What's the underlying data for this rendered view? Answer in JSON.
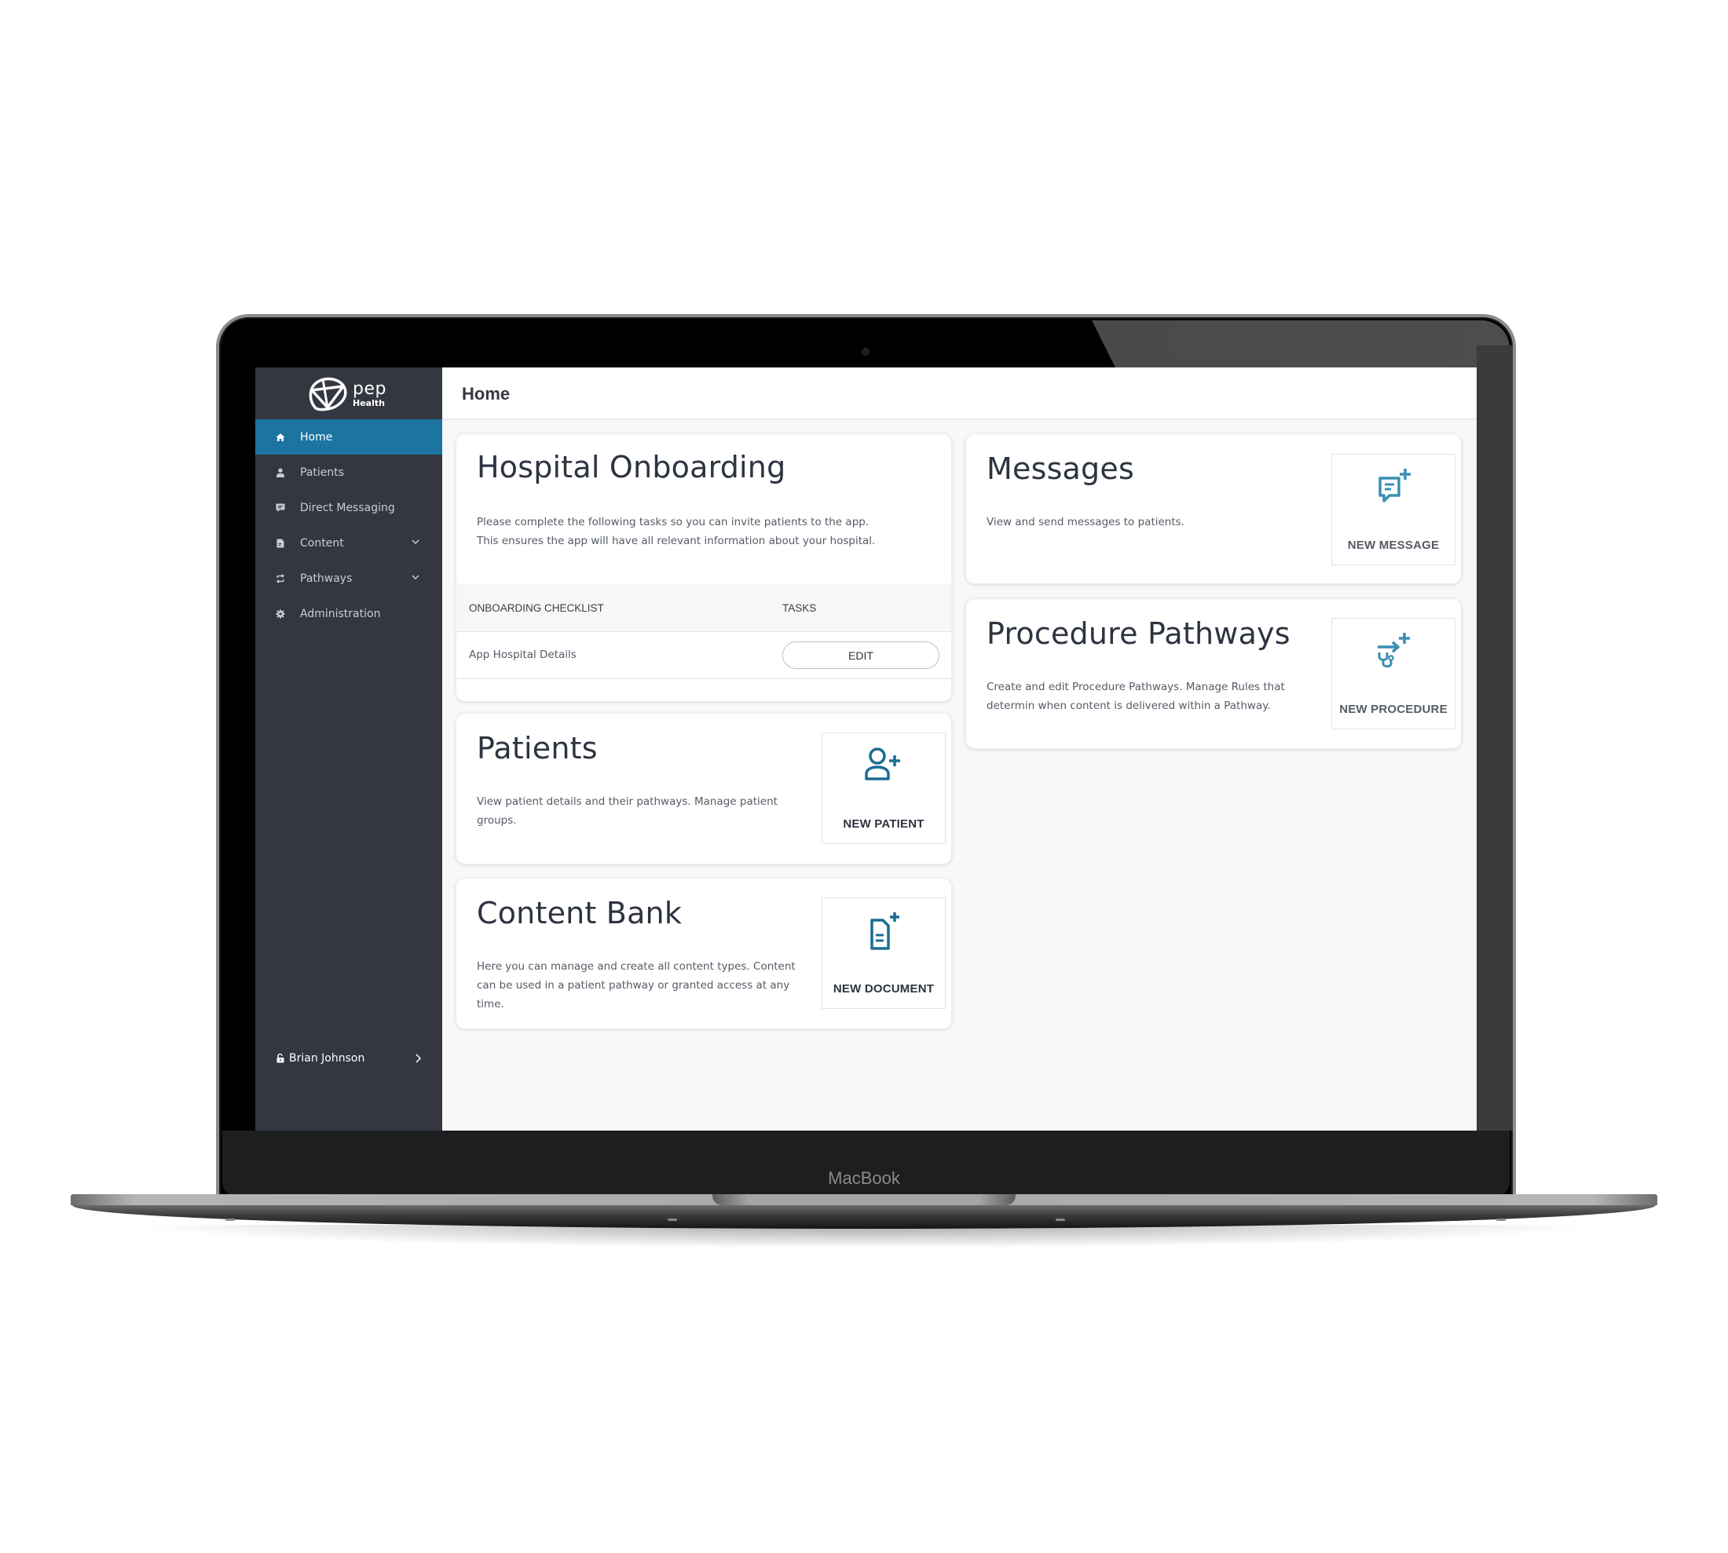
{
  "device": {
    "label": "MacBook"
  },
  "brand": {
    "name": "pep",
    "sub": "Health",
    "accent": "#1d74a0",
    "icon_color": "#1a6d94",
    "icon_color_light": "#3a8fb3"
  },
  "sidebar": {
    "items": [
      {
        "label": "Home",
        "icon": "home-icon",
        "active": true
      },
      {
        "label": "Patients",
        "icon": "user-icon"
      },
      {
        "label": "Direct Messaging",
        "icon": "chat-icon"
      },
      {
        "label": "Content",
        "icon": "document-icon",
        "expandable": true
      },
      {
        "label": "Pathways",
        "icon": "swap-icon",
        "expandable": true
      },
      {
        "label": "Administration",
        "icon": "gear-icon"
      }
    ],
    "user": {
      "name": "Brian Johnson",
      "icon": "unlock-icon"
    }
  },
  "header": {
    "title": "Home"
  },
  "cards": {
    "onboarding": {
      "title": "Hospital Onboarding",
      "desc_line1": "Please complete the following tasks so you can invite patients to the app.",
      "desc_line2": "This ensures the app will have all relevant information about your hospital.",
      "columns": [
        "ONBOARDING CHECKLIST",
        "TASKS"
      ],
      "rows": [
        {
          "label": "App Hospital Details",
          "action": "EDIT"
        }
      ]
    },
    "patients": {
      "title": "Patients",
      "desc_line1": "View patient details and their pathways. Manage patient",
      "desc_line2": "groups.",
      "action": "NEW PATIENT"
    },
    "content_bank": {
      "title": "Content Bank",
      "desc_line1": "Here you can manage and create all content types. Content",
      "desc_line2": "can be used in a patient pathway or granted access at any",
      "desc_line3": "time.",
      "action": "NEW DOCUMENT"
    },
    "messages": {
      "title": "Messages",
      "desc_line1": "View and send messages to patients.",
      "action": "NEW MESSAGE"
    },
    "procedures": {
      "title": "Procedure Pathways",
      "desc_line1": "Create and edit Procedure Pathways. Manage Rules that",
      "desc_line2": "determin when content is delivered within a Pathway.",
      "action": "NEW PROCEDURE"
    }
  }
}
